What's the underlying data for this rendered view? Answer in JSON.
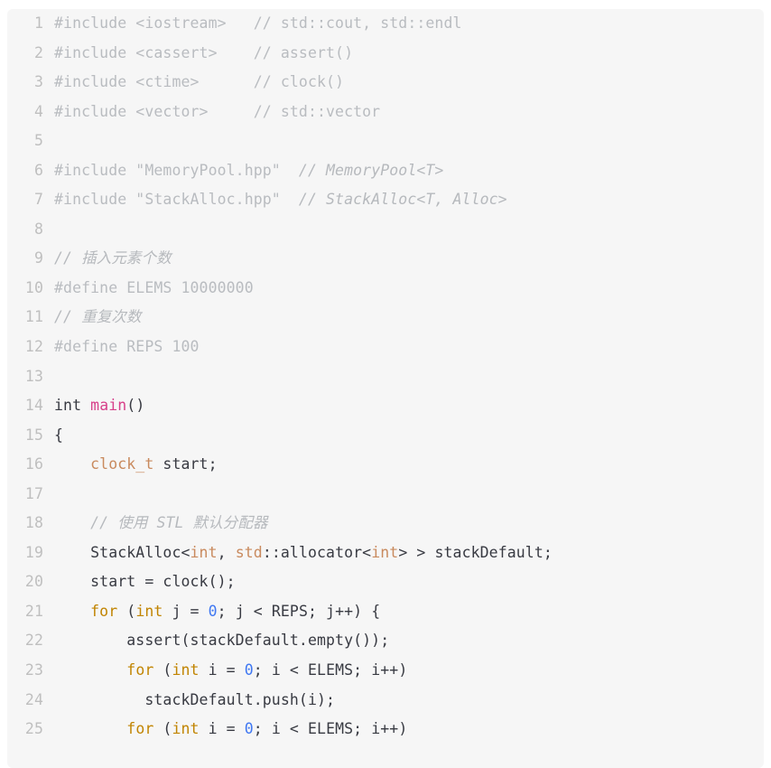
{
  "editor": {
    "language": "cpp",
    "background": "#f6f6f6",
    "page_background": "#ffffff",
    "gutter_color": "#bfbfbf",
    "colors": {
      "plain": "#383a42",
      "faded_preprocessor": "#b9bcc0",
      "comment": "#b6b9bd",
      "keyword": "#c18401",
      "function": "#d7408a",
      "number": "#4078f2",
      "type": "#c98a5e"
    },
    "first_line_number": 1,
    "last_line_number": 25,
    "lines": [
      {
        "n": "1",
        "tokens": [
          {
            "text": "#include <iostream>   // std::cout, std::endl",
            "cls": "t-faded"
          }
        ]
      },
      {
        "n": "2",
        "tokens": [
          {
            "text": "#include <cassert>    // assert()",
            "cls": "t-faded"
          }
        ]
      },
      {
        "n": "3",
        "tokens": [
          {
            "text": "#include <ctime>      // clock()",
            "cls": "t-faded"
          }
        ]
      },
      {
        "n": "4",
        "tokens": [
          {
            "text": "#include <vector>     // std::vector",
            "cls": "t-faded"
          }
        ]
      },
      {
        "n": "5",
        "tokens": [
          {
            "text": "",
            "cls": "t-plain"
          }
        ]
      },
      {
        "n": "6",
        "tokens": [
          {
            "text": "#include \"MemoryPool.hpp\"  ",
            "cls": "t-faded"
          },
          {
            "text": "// MemoryPool<T>",
            "cls": "t-comment"
          }
        ]
      },
      {
        "n": "7",
        "tokens": [
          {
            "text": "#include \"StackAlloc.hpp\"  ",
            "cls": "t-faded"
          },
          {
            "text": "// StackAlloc<T, Alloc>",
            "cls": "t-comment"
          }
        ]
      },
      {
        "n": "8",
        "tokens": [
          {
            "text": "",
            "cls": "t-plain"
          }
        ]
      },
      {
        "n": "9",
        "tokens": [
          {
            "text": "// 插入元素个数",
            "cls": "t-comment"
          }
        ]
      },
      {
        "n": "10",
        "tokens": [
          {
            "text": "#define ELEMS 10000000",
            "cls": "t-faded"
          }
        ]
      },
      {
        "n": "11",
        "tokens": [
          {
            "text": "// 重复次数",
            "cls": "t-comment"
          }
        ]
      },
      {
        "n": "12",
        "tokens": [
          {
            "text": "#define REPS 100",
            "cls": "t-faded"
          }
        ]
      },
      {
        "n": "13",
        "tokens": [
          {
            "text": "",
            "cls": "t-plain"
          }
        ]
      },
      {
        "n": "14",
        "tokens": [
          {
            "text": "int",
            "cls": "t-plain"
          },
          {
            "text": " ",
            "cls": "t-plain"
          },
          {
            "text": "main",
            "cls": "t-fn"
          },
          {
            "text": "()",
            "cls": "t-punc"
          }
        ]
      },
      {
        "n": "15",
        "tokens": [
          {
            "text": "{",
            "cls": "t-punc"
          }
        ]
      },
      {
        "n": "16",
        "tokens": [
          {
            "text": "    ",
            "cls": "t-plain"
          },
          {
            "text": "clock_t",
            "cls": "t-type"
          },
          {
            "text": " start;",
            "cls": "t-plain"
          }
        ]
      },
      {
        "n": "17",
        "tokens": [
          {
            "text": "",
            "cls": "t-plain"
          }
        ]
      },
      {
        "n": "18",
        "tokens": [
          {
            "text": "    ",
            "cls": "t-plain"
          },
          {
            "text": "// 使用 STL 默认分配器",
            "cls": "t-comment"
          }
        ]
      },
      {
        "n": "19",
        "tokens": [
          {
            "text": "    StackAlloc<",
            "cls": "t-plain"
          },
          {
            "text": "int",
            "cls": "t-type"
          },
          {
            "text": ", ",
            "cls": "t-plain"
          },
          {
            "text": "std",
            "cls": "t-type"
          },
          {
            "text": "::allocator<",
            "cls": "t-plain"
          },
          {
            "text": "int",
            "cls": "t-type"
          },
          {
            "text": "> > stackDefault;",
            "cls": "t-plain"
          }
        ]
      },
      {
        "n": "20",
        "tokens": [
          {
            "text": "    start = clock();",
            "cls": "t-plain"
          }
        ]
      },
      {
        "n": "21",
        "tokens": [
          {
            "text": "    ",
            "cls": "t-plain"
          },
          {
            "text": "for",
            "cls": "t-kw"
          },
          {
            "text": " (",
            "cls": "t-plain"
          },
          {
            "text": "int",
            "cls": "t-kw"
          },
          {
            "text": " j = ",
            "cls": "t-plain"
          },
          {
            "text": "0",
            "cls": "t-num"
          },
          {
            "text": "; j < REPS; j++) {",
            "cls": "t-plain"
          }
        ]
      },
      {
        "n": "22",
        "tokens": [
          {
            "text": "        assert(stackDefault.empty());",
            "cls": "t-plain"
          }
        ]
      },
      {
        "n": "23",
        "tokens": [
          {
            "text": "        ",
            "cls": "t-plain"
          },
          {
            "text": "for",
            "cls": "t-kw"
          },
          {
            "text": " (",
            "cls": "t-plain"
          },
          {
            "text": "int",
            "cls": "t-kw"
          },
          {
            "text": " i = ",
            "cls": "t-plain"
          },
          {
            "text": "0",
            "cls": "t-num"
          },
          {
            "text": "; i < ELEMS; i++)",
            "cls": "t-plain"
          }
        ]
      },
      {
        "n": "24",
        "tokens": [
          {
            "text": "          stackDefault.push(i);",
            "cls": "t-plain"
          }
        ]
      },
      {
        "n": "25",
        "tokens": [
          {
            "text": "        ",
            "cls": "t-plain"
          },
          {
            "text": "for",
            "cls": "t-kw"
          },
          {
            "text": " (",
            "cls": "t-plain"
          },
          {
            "text": "int",
            "cls": "t-kw"
          },
          {
            "text": " i = ",
            "cls": "t-plain"
          },
          {
            "text": "0",
            "cls": "t-num"
          },
          {
            "text": "; i < ELEMS; i++)",
            "cls": "t-plain"
          }
        ]
      }
    ]
  }
}
